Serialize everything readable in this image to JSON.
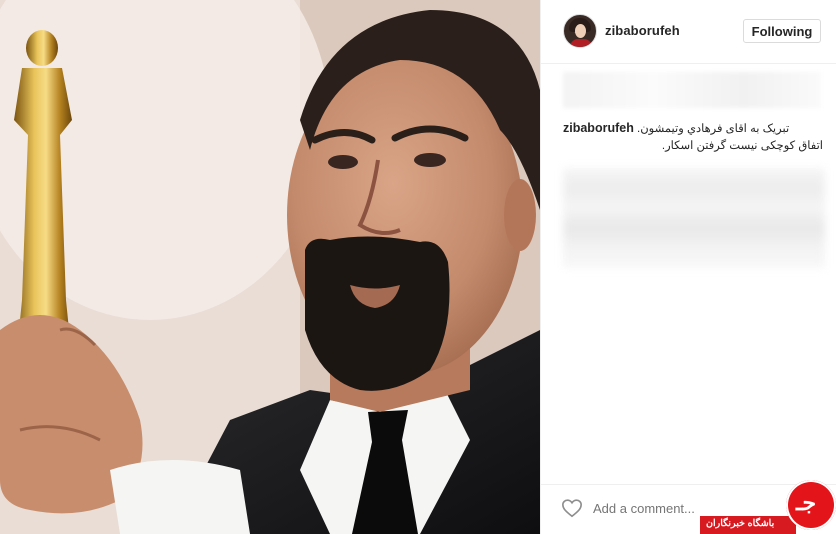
{
  "post": {
    "username": "ziba​borufeh",
    "follow_button": "Following",
    "caption_user": "zibaborufeh",
    "caption_line1": "تبریک به اقای فرهادي وتیمشون.",
    "caption_line2": "اتفاق کوچکی نیست گرفتن اسکار.",
    "comment_placeholder": "Add a comment..."
  },
  "icons": {
    "like": "heart-outline-icon",
    "avatar": "profile-avatar"
  },
  "watermark": {
    "text": "باشگاه خبرنگاران",
    "glyph": "جـ",
    "color": "#d71920"
  },
  "colors": {
    "text": "#262626",
    "muted": "#999999",
    "border": "#dbdbdb"
  }
}
